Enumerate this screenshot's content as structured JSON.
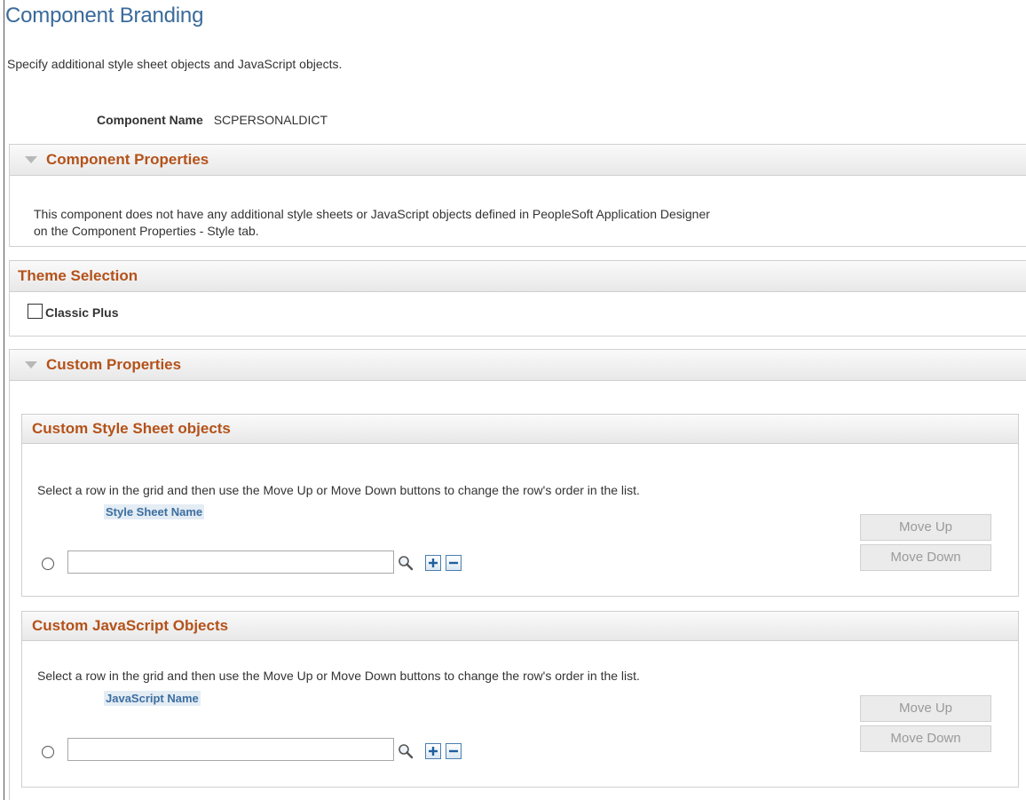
{
  "page": {
    "title": "Component Branding",
    "instructions": "Specify additional style sheet objects and JavaScript objects."
  },
  "component": {
    "name_label": "Component Name",
    "name_value": "SCPERSONALDICT"
  },
  "component_properties": {
    "title": "Component Properties",
    "message_line1": "This component does not have any additional style sheets or JavaScript objects defined in PeopleSoft Application Designer",
    "message_line2": "on the Component Properties - Style tab."
  },
  "theme_selection": {
    "title": "Theme Selection",
    "option_label": "Classic Plus",
    "option_checked": false
  },
  "custom_properties": {
    "title": "Custom Properties"
  },
  "style_sheets": {
    "title": "Custom Style Sheet objects",
    "help": "Select a row in the grid and then use the Move Up or Move Down buttons to change the row's order in the list.",
    "column_header": "Style Sheet Name",
    "input_value": "",
    "move_up": "Move Up",
    "move_down": "Move Down"
  },
  "javascript": {
    "title": "Custom JavaScript Objects",
    "help": "Select a row in the grid and then use the Move Up or Move Down buttons to change the row's order in the list.",
    "column_header": "JavaScript Name",
    "input_value": "",
    "move_up": "Move Up",
    "move_down": "Move Down"
  },
  "icons": {
    "collapse": "triangle-down-icon",
    "lookup": "magnifier-icon",
    "add_row": "plus-icon",
    "delete_row": "minus-icon"
  },
  "colors": {
    "title": "#3a6a9a",
    "section_title": "#b4521a",
    "column_header": "#3c6fa0"
  }
}
